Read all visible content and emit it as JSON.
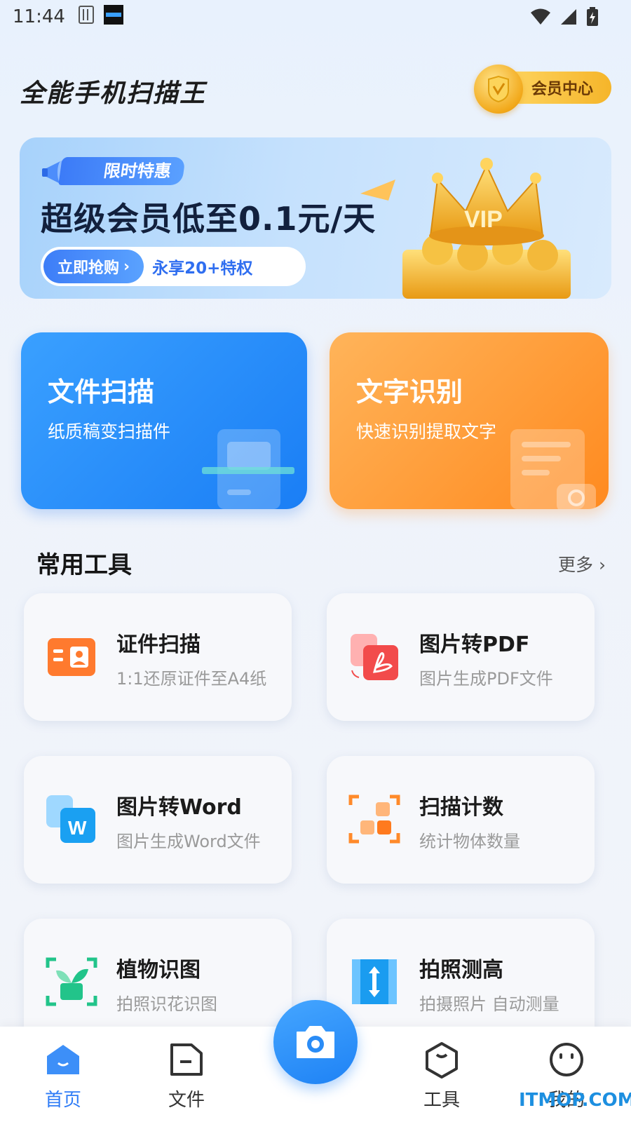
{
  "status_bar": {
    "time": "11:44"
  },
  "header": {
    "title": "全能手机扫描王",
    "vip_center_label": "会员中心"
  },
  "banner": {
    "tag": "限时特惠",
    "headline": "超级会员低至0.1元/天",
    "cta_label": "立即抢购",
    "cta_note": "永享20+特权",
    "crown_text": "VIP"
  },
  "feature_cards": [
    {
      "title": "文件扫描",
      "subtitle": "纸质稿变扫描件"
    },
    {
      "title": "文字识别",
      "subtitle": "快速识别提取文字"
    }
  ],
  "tools_section": {
    "title": "常用工具",
    "more": "更多 ›"
  },
  "tools": [
    {
      "name": "证件扫描",
      "desc": "1:1还原证件至A4纸"
    },
    {
      "name": "图片转PDF",
      "desc": "图片生成PDF文件"
    },
    {
      "name": "图片转Word",
      "desc": "图片生成Word文件"
    },
    {
      "name": "扫描计数",
      "desc": "统计物体数量"
    },
    {
      "name": "植物识图",
      "desc": "拍照识花识图"
    },
    {
      "name": "拍照测高",
      "desc": "拍摄照片 自动测量"
    }
  ],
  "tab_bar": {
    "items": [
      {
        "label": "首页"
      },
      {
        "label": "文件"
      },
      {
        "label": "工具"
      },
      {
        "label": "我的"
      }
    ],
    "active": "首页"
  },
  "watermark": "ITMOP.COM",
  "colors": {
    "primary": "#2f7cf6",
    "orange": "#ff8a1f",
    "gold": "#f5b52a"
  }
}
